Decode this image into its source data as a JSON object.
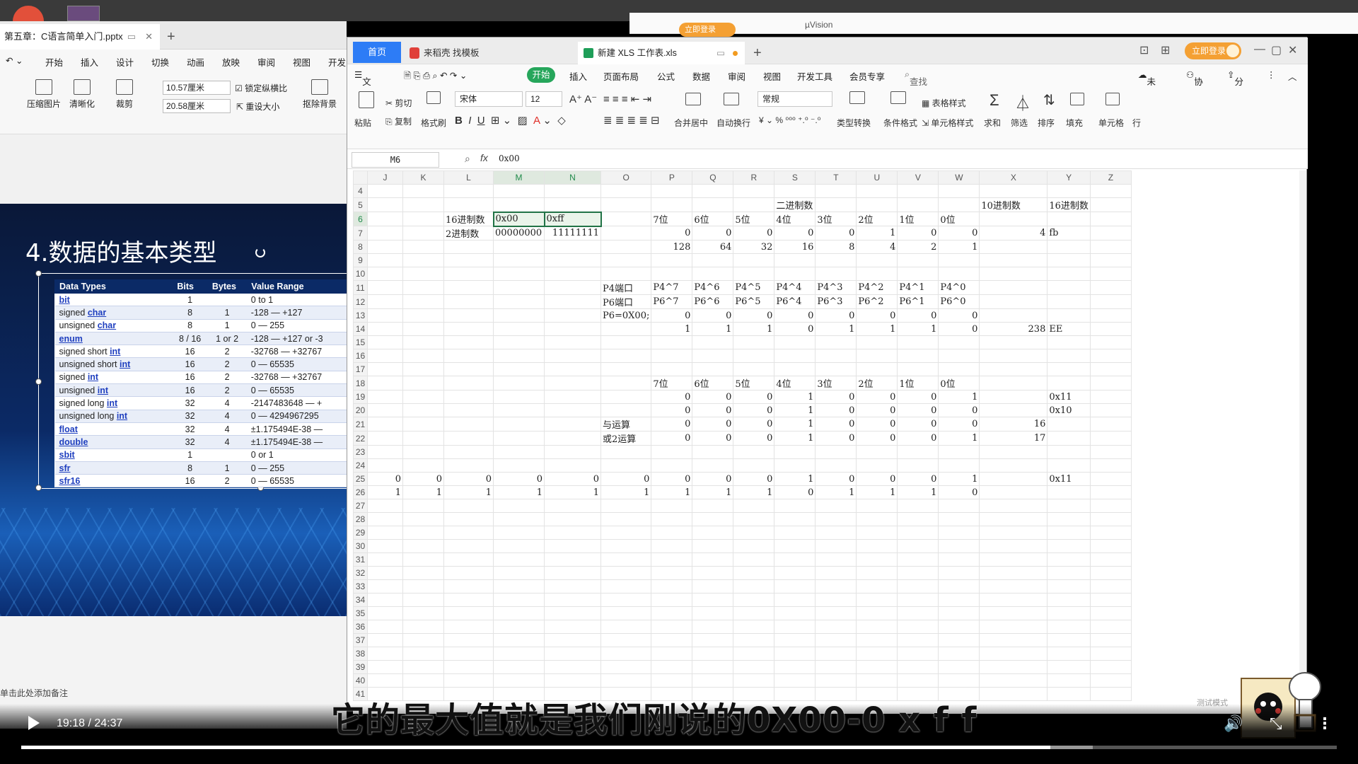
{
  "ppt": {
    "tab_title": "第五章：C语言简单入门.pptx",
    "menu": [
      "开始",
      "插入",
      "设计",
      "切换",
      "动画",
      "放映",
      "审阅",
      "视图",
      "开发"
    ],
    "tools": {
      "compress": "压缩图片",
      "sharpen": "清晰化",
      "crop": "裁剪",
      "width": "10.57厘米",
      "height": "20.58厘米",
      "lock_ratio": "锁定纵横比",
      "reset_size": "重设大小",
      "remove_bg": "抠除背景"
    },
    "slide_title": "4.数据的基本类型",
    "notes_hint": "单击此处添加备注",
    "table_header": [
      "Data Types",
      "Bits",
      "Bytes",
      "Value Range"
    ],
    "table_rows": [
      [
        "bit",
        "",
        "1",
        "",
        "0 to 1"
      ],
      [
        "signed ",
        "char",
        "8",
        "1",
        "-128 — +127"
      ],
      [
        "unsigned ",
        "char",
        "8",
        "1",
        "0 — 255"
      ],
      [
        "enum",
        "",
        "8 / 16",
        "1 or 2",
        "-128 — +127 or -3"
      ],
      [
        "signed short ",
        "int",
        "16",
        "2",
        "-32768 — +32767"
      ],
      [
        "unsigned short ",
        "int",
        "16",
        "2",
        "0 — 65535"
      ],
      [
        "signed ",
        "int",
        "16",
        "2",
        "-32768 — +32767"
      ],
      [
        "unsigned ",
        "int",
        "16",
        "2",
        "0 — 65535"
      ],
      [
        "signed long ",
        "int",
        "32",
        "4",
        "-2147483648 — +"
      ],
      [
        "unsigned long ",
        "int",
        "32",
        "4",
        "0 — 4294967295"
      ],
      [
        "float",
        "",
        "32",
        "4",
        "±1.175494E-38 —"
      ],
      [
        "double",
        "",
        "32",
        "4",
        "±1.175494E-38 —"
      ],
      [
        "sbit",
        "",
        "1",
        "",
        "0 or 1"
      ],
      [
        "sfr",
        "",
        "8",
        "1",
        "0 — 255"
      ],
      [
        "sfr16",
        "",
        "16",
        "2",
        "0 — 65535"
      ]
    ]
  },
  "back_window": {
    "title": "µVision",
    "login": "立即登录"
  },
  "wps": {
    "tabs": {
      "home": "首页",
      "tab1": "来稻壳 找模板",
      "tab2": "新建 XLS 工作表.xls"
    },
    "login": "立即登录",
    "menu": [
      "文件",
      "开始",
      "插入",
      "页面布局",
      "公式",
      "数据",
      "审阅",
      "视图",
      "开发工具",
      "会员专享",
      "查找命令、搜索模板",
      "未同步",
      "协作",
      "分享"
    ],
    "tools": {
      "paste": "粘贴",
      "cut": "剪切",
      "copy": "复制",
      "format_painter": "格式刷",
      "font": "宋体",
      "size": "12",
      "merge": "合并居中",
      "wrap": "自动换行",
      "number_format": "常规",
      "type_convert": "类型转换",
      "cond_format": "条件格式",
      "table_style": "表格样式",
      "cell_style": "单元格样式",
      "sum": "求和",
      "filter": "筛选",
      "sort": "排序",
      "fill": "填充",
      "cell": "单元格",
      "row_col": "行"
    },
    "namebox": "M6",
    "formula": "0x00",
    "columns": [
      "J",
      "K",
      "L",
      "M",
      "N",
      "O",
      "P",
      "Q",
      "R",
      "S",
      "T",
      "U",
      "V",
      "W",
      "X",
      "Y",
      "Z"
    ],
    "rows": {
      "4": {},
      "5": {
        "S": "二进制数",
        "X": "10进制数",
        "Y": "16进制数"
      },
      "6": {
        "L": "16进制数",
        "M": "0x00",
        "N": "0xff",
        "P": "7位",
        "Q": "6位",
        "R": "5位",
        "S": "4位",
        "T": "3位",
        "U": "2位",
        "V": "1位",
        "W": "0位"
      },
      "7": {
        "L": "2进制数",
        "M": "00000000",
        "N": "11111111",
        "P": "0",
        "Q": "0",
        "R": "0",
        "S": "0",
        "T": "0",
        "U": "1",
        "V": "0",
        "W": "0",
        "X": "4",
        "Y": "fb"
      },
      "8": {
        "P": "128",
        "Q": "64",
        "R": "32",
        "S": "16",
        "T": "8",
        "U": "4",
        "V": "2",
        "W": "1"
      },
      "11": {
        "O": "P4端口",
        "P": "P4^7",
        "Q": "P4^6",
        "R": "P4^5",
        "S": "P4^4",
        "T": "P4^3",
        "U": "P4^2",
        "V": "P4^1",
        "W": "P4^0"
      },
      "12": {
        "O": "P6端口",
        "P": "P6^7",
        "Q": "P6^6",
        "R": "P6^5",
        "S": "P6^4",
        "T": "P6^3",
        "U": "P6^2",
        "V": "P6^1",
        "W": "P6^0"
      },
      "13": {
        "O": "P6=0X00;",
        "P": "0",
        "Q": "0",
        "R": "0",
        "S": "0",
        "T": "0",
        "U": "0",
        "V": "0",
        "W": "0"
      },
      "14": {
        "P": "1",
        "Q": "1",
        "R": "1",
        "S": "0",
        "T": "1",
        "U": "1",
        "V": "1",
        "W": "0",
        "X": "238",
        "Y": "EE"
      },
      "18": {
        "P": "7位",
        "Q": "6位",
        "R": "5位",
        "S": "4位",
        "T": "3位",
        "U": "2位",
        "V": "1位",
        "W": "0位"
      },
      "19": {
        "P": "0",
        "Q": "0",
        "R": "0",
        "S": "1",
        "T": "0",
        "U": "0",
        "V": "0",
        "W": "1",
        "Y": "0x11"
      },
      "20": {
        "P": "0",
        "Q": "0",
        "R": "0",
        "S": "1",
        "T": "0",
        "U": "0",
        "V": "0",
        "W": "0",
        "Y": "0x10"
      },
      "21": {
        "O": "与运算",
        "P": "0",
        "Q": "0",
        "R": "0",
        "S": "1",
        "T": "0",
        "U": "0",
        "V": "0",
        "W": "0",
        "X": "16"
      },
      "22": {
        "O": "或2运算",
        "P": "0",
        "Q": "0",
        "R": "0",
        "S": "1",
        "T": "0",
        "U": "0",
        "V": "0",
        "W": "1",
        "X": "17"
      },
      "25": {
        "J": "0",
        "K": "0",
        "L": "0",
        "M": "0",
        "N": "0",
        "O": "0",
        "P": "0",
        "Q": "0",
        "R": "0",
        "S": "1",
        "T": "0",
        "U": "0",
        "V": "0",
        "W": "1",
        "Y": "0x11"
      },
      "26": {
        "J": "1",
        "K": "1",
        "L": "1",
        "M": "1",
        "N": "1",
        "O": "1",
        "P": "1",
        "Q": "1",
        "R": "1",
        "S": "0",
        "T": "1",
        "U": "1",
        "V": "1",
        "W": "0"
      }
    },
    "row_count_last": 41
  },
  "player": {
    "subtitle": "它的最大值就是我们刚说的0X00-0 x f f",
    "time": "19:18 / 24:37",
    "progress_fraction": 0.782,
    "watermark": "测试模式"
  }
}
